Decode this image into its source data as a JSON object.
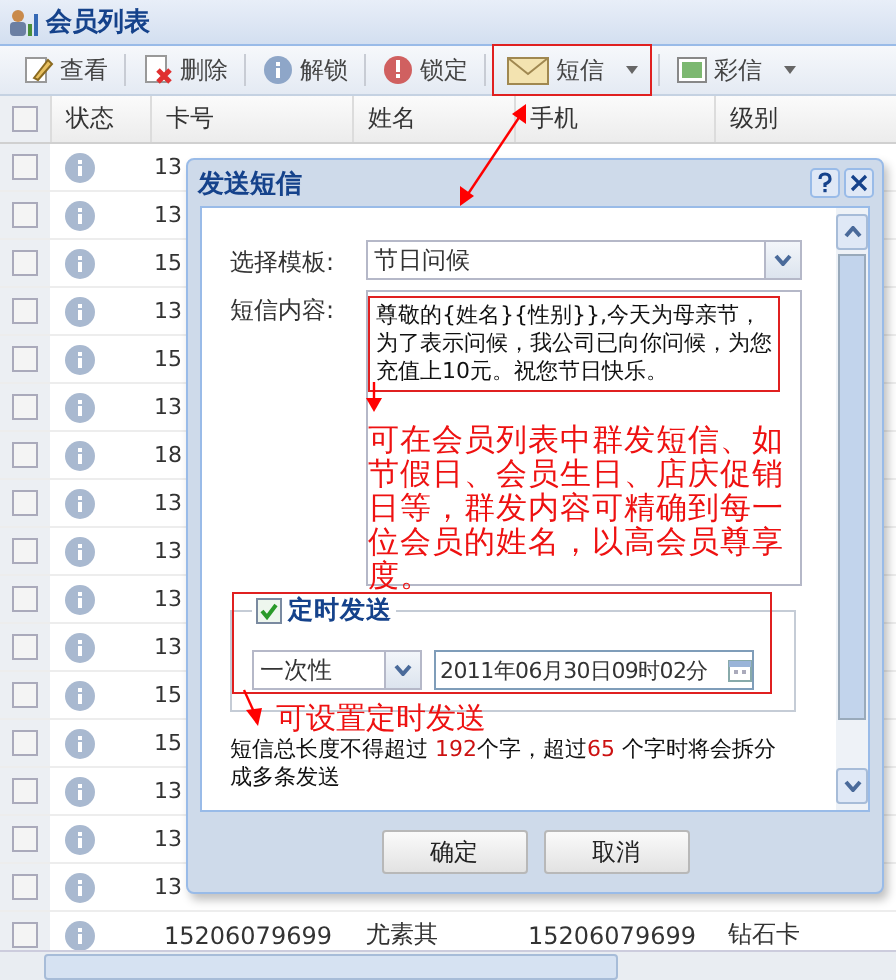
{
  "panel": {
    "title": "会员列表"
  },
  "toolbar": [
    {
      "label": "查看",
      "has_menu": false,
      "highlighted": false
    },
    {
      "label": "删除",
      "has_menu": false,
      "highlighted": false
    },
    {
      "label": "解锁",
      "has_menu": false,
      "highlighted": false
    },
    {
      "label": "锁定",
      "has_menu": false,
      "highlighted": false
    },
    {
      "label": "短信",
      "has_menu": true,
      "highlighted": true
    },
    {
      "label": "彩信",
      "has_menu": true,
      "highlighted": false
    }
  ],
  "table": {
    "all_checked": false,
    "columns": [
      "状态",
      "卡号",
      "姓名",
      "手机",
      "级别"
    ],
    "rows": [
      {
        "checked": false,
        "card": "13"
      },
      {
        "checked": false,
        "card": "13"
      },
      {
        "checked": false,
        "card": "15"
      },
      {
        "checked": false,
        "card": "13"
      },
      {
        "checked": false,
        "card": "15"
      },
      {
        "checked": false,
        "card": "13"
      },
      {
        "checked": false,
        "card": "18"
      },
      {
        "checked": false,
        "card": "13"
      },
      {
        "checked": false,
        "card": "13"
      },
      {
        "checked": false,
        "card": "13"
      },
      {
        "checked": false,
        "card": "13"
      },
      {
        "checked": false,
        "card": "15"
      },
      {
        "checked": false,
        "card": "15"
      },
      {
        "checked": false,
        "card": "13"
      },
      {
        "checked": false,
        "card": "13"
      },
      {
        "checked": false,
        "card": "13"
      },
      {
        "checked": false,
        "card": "15206079699",
        "name": "尤素其",
        "phone": "15206079699",
        "level": "钻石卡"
      }
    ]
  },
  "dialog": {
    "title": "发送短信",
    "template_label": "选择模板:",
    "template_value": "节日问候",
    "content_label": "短信内容:",
    "content_value": "尊敬的{姓名}{性别}},今天为母亲节，为了表示问候，我公司已向你问候，为您充值上10元。祝您节日快乐。",
    "content_note": "可在会员列表中群发短信、如节假日、会员生日、店庆促销日等，群发内容可精确到每一位会员的姓名，以高会员尊享度。",
    "schedule": {
      "label": "定时发送",
      "checked": true,
      "frequency": "一次性",
      "datetime": "2011年06月30日09时02分",
      "note": "可设置定时发送"
    },
    "limit_note": [
      {
        "kind": "plain",
        "text": "短信总长度不得超过 "
      },
      {
        "kind": "number",
        "text": "192"
      },
      {
        "kind": "plain",
        "text": "个字，超过"
      },
      {
        "kind": "number",
        "text": "65"
      },
      {
        "kind": "plain",
        "text": " 个字时将会拆分成多条发送"
      }
    ],
    "buttons": [
      "确定",
      "取消"
    ]
  }
}
